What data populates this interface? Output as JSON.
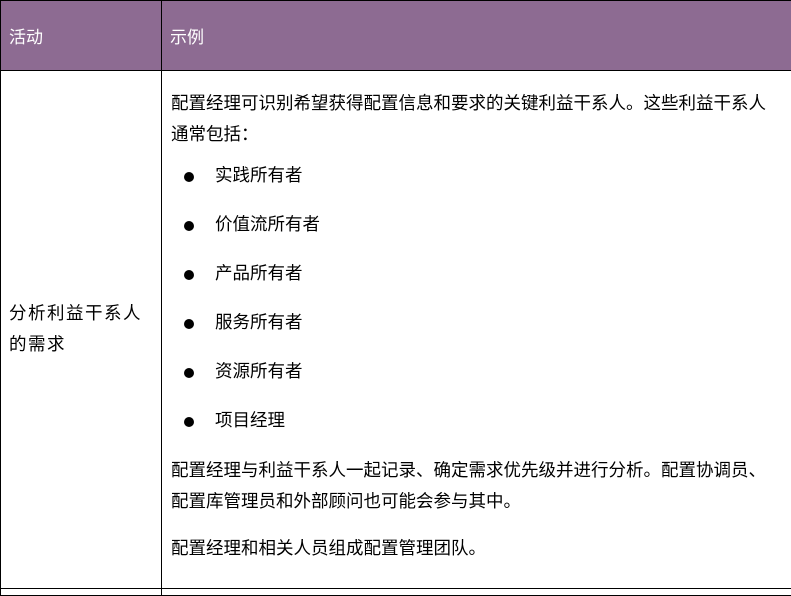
{
  "table": {
    "headers": {
      "activity": "活动",
      "example": "示例"
    },
    "row": {
      "activity": "分析利益干系人的需求",
      "intro": "配置经理可识别希望获得配置信息和要求的关键利益干系人。这些利益干系人通常包括：",
      "stakeholders": [
        "实践所有者",
        "价值流所有者",
        "产品所有者",
        "服务所有者",
        "资源所有者",
        "项目经理"
      ],
      "collaboration": "配置经理与利益干系人一起记录、确定需求优先级并进行分析。配置协调员、配置库管理员和外部顾问也可能会参与其中。",
      "team": "配置经理和相关人员组成配置管理团队。"
    }
  },
  "colors": {
    "header_background": "#8d6b92",
    "header_text": "#ffffff",
    "border": "#000000"
  }
}
